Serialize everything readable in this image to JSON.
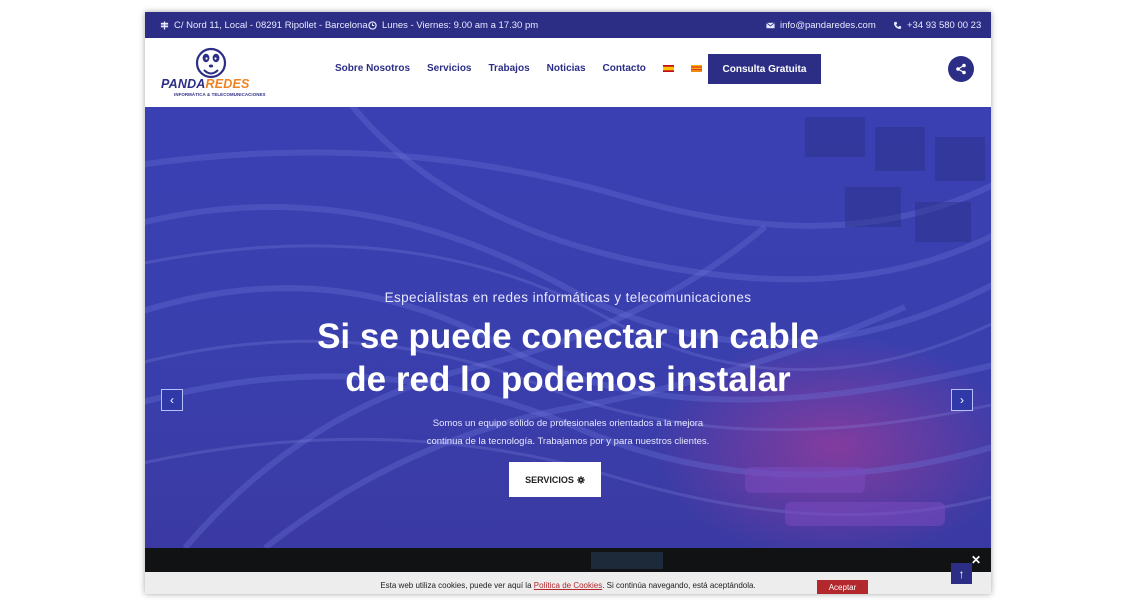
{
  "topbar": {
    "address": "C/ Nord 11, Local - 08291 Ripollet - Barcelona",
    "hours": "Lunes - Viernes: 9.00 am a 17.30 pm",
    "email": "info@pandaredes.com",
    "phone": "+34 93 580 00 23"
  },
  "logo": {
    "word_part1": "PANDA",
    "word_part2": "REDES",
    "tagline": "INFORMÁTICA & TELECOMUNICACIONES"
  },
  "nav": {
    "items": [
      "Sobre Nosotros",
      "Servicios",
      "Trabajos",
      "Noticias",
      "Contacto"
    ],
    "cta": "Consulta Gratuita"
  },
  "hero": {
    "subtitle": "Especialistas en redes informáticas y telecomunicaciones",
    "title_line1": "Si se puede conectar un cable",
    "title_line2": "de red lo podemos instalar",
    "desc_line1": "Somos un equipo sólido de profesionales orientados a la mejora",
    "desc_line2": "continua de la tecnología. Trabajamos por y para nuestros clientes.",
    "button": "SERVICIOS"
  },
  "cookie": {
    "text_before": "Esta web utiliza cookies, puede ver aquí la ",
    "link": "Política de Cookies",
    "text_after": ". Si continúa navegando, está aceptándola.",
    "accept": "Aceptar"
  },
  "icons": {
    "address": "signpost-icon",
    "hours": "clock-icon",
    "email": "envelope-icon",
    "phone": "phone-icon",
    "share": "share-icon"
  },
  "colors": {
    "brand": "#2c2e86",
    "accent": "#f08321",
    "cookie_accent": "#b3282d"
  }
}
